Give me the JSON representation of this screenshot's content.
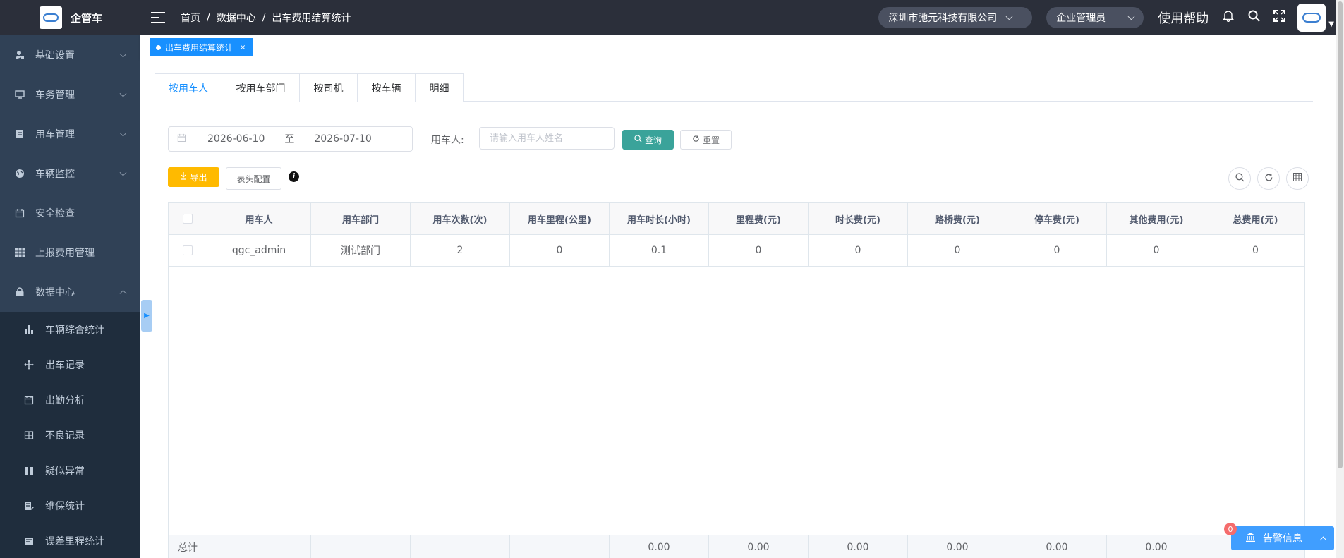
{
  "app": {
    "title": "企管车"
  },
  "sidebar": {
    "items": [
      {
        "label": "基础设置",
        "icon": "user-settings-icon"
      },
      {
        "label": "车务管理",
        "icon": "monitor-icon"
      },
      {
        "label": "用车管理",
        "icon": "document-icon"
      },
      {
        "label": "车辆监控",
        "icon": "globe-icon"
      },
      {
        "label": "安全检查",
        "icon": "calendar-icon"
      },
      {
        "label": "上报费用管理",
        "icon": "grid-icon"
      },
      {
        "label": "数据中心",
        "icon": "lock-icon"
      }
    ],
    "sub_items": [
      {
        "label": "车辆综合统计",
        "icon": "bar-chart-icon"
      },
      {
        "label": "出车记录",
        "icon": "move-icon"
      },
      {
        "label": "出勤分析",
        "icon": "calendar-icon"
      },
      {
        "label": "不良记录",
        "icon": "table-icon"
      },
      {
        "label": "疑似异常",
        "icon": "book-icon"
      },
      {
        "label": "维保统计",
        "icon": "edit-doc-icon"
      },
      {
        "label": "误差里程统计",
        "icon": "card-icon"
      }
    ]
  },
  "header": {
    "breadcrumb": [
      "首页",
      "数据中心",
      "出车费用结算统计"
    ],
    "breadcrumb_sep": "/",
    "company": "深圳市弛元科技有限公司",
    "role": "企业管理员",
    "help": "使用帮助"
  },
  "tagsview": {
    "active_tag": "出车费用结算统计",
    "close": "×"
  },
  "tabs": [
    "按用车人",
    "按用车部门",
    "按司机",
    "按车辆",
    "明细"
  ],
  "filters": {
    "date_start": "2026-06-10",
    "date_to": "至",
    "date_end": "2026-07-10",
    "user_label": "用车人:",
    "user_placeholder": "请输入用车人姓名",
    "query": "查询",
    "reset": "重置"
  },
  "toolbar": {
    "export": "导出",
    "header_config": "表头配置",
    "info": "i"
  },
  "table": {
    "columns": [
      "用车人",
      "用车部门",
      "用车次数(次)",
      "用车里程(公里)",
      "用车时长(小时)",
      "里程费(元)",
      "时长费(元)",
      "路桥费(元)",
      "停车费(元)",
      "其他费用(元)",
      "总费用(元)"
    ],
    "rows": [
      [
        "qgc_admin",
        "测试部门",
        "2",
        "0",
        "0.1",
        "0",
        "0",
        "0",
        "0",
        "0",
        "0"
      ]
    ],
    "footer": [
      "总计",
      "",
      "",
      "",
      "",
      "0.00",
      "0.00",
      "0.00",
      "0.00",
      "0.00",
      "0.00"
    ]
  },
  "alarm": {
    "label": "告警信息",
    "count": "0"
  }
}
